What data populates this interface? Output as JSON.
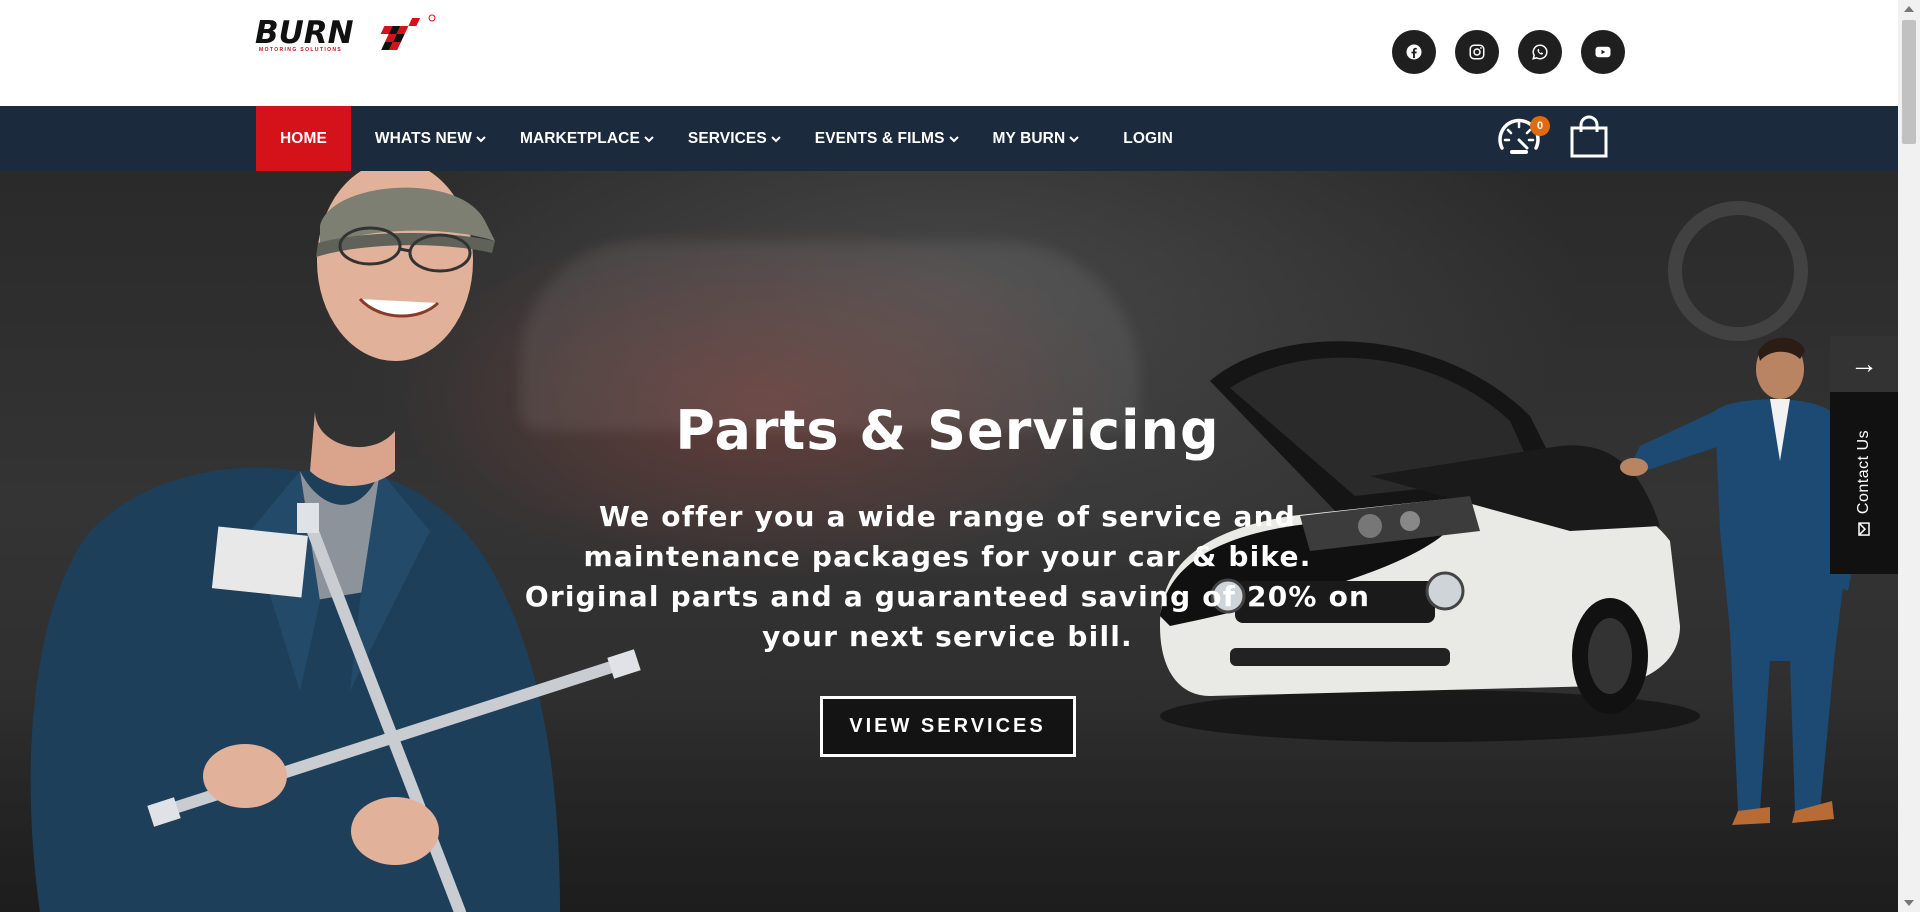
{
  "brand": {
    "name": "BURN",
    "tagline": "MOTORING SOLUTIONS",
    "accent": "#d5121a",
    "navy": "#1b2a3d"
  },
  "socials": [
    {
      "name": "facebook-icon"
    },
    {
      "name": "instagram-icon"
    },
    {
      "name": "whatsapp-icon"
    },
    {
      "name": "youtube-icon"
    }
  ],
  "nav": {
    "items": [
      {
        "label": "HOME",
        "active": true
      },
      {
        "label": "WHATS NEW",
        "dropdown": true
      },
      {
        "label": "MARKETPLACE",
        "dropdown": true
      },
      {
        "label": "SERVICES",
        "dropdown": true
      },
      {
        "label": "EVENTS & FILMS",
        "dropdown": true
      },
      {
        "label": "MY BURN",
        "dropdown": true
      },
      {
        "label": "LOGIN"
      }
    ],
    "garage_count": "0"
  },
  "hero": {
    "title": "Parts & Servicing",
    "text": "We offer you a wide range of service and maintenance packages for your car & bike. Original parts and a guaranteed saving of 20% on your next service bill.",
    "button": "VIEW SERVICES"
  },
  "side": {
    "arrow": "→",
    "contact": "Contact Us"
  }
}
